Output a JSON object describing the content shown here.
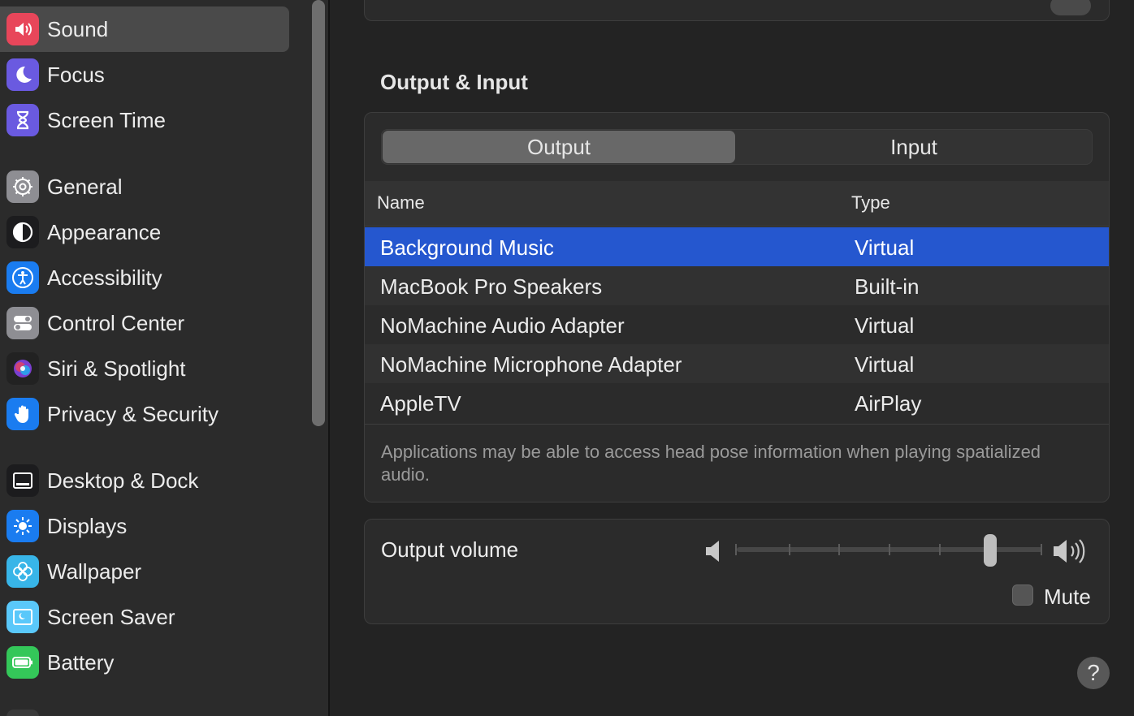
{
  "sidebar": {
    "items": [
      {
        "label": "Sound",
        "icon": "speaker-icon",
        "color": "#e8465a"
      },
      {
        "label": "Focus",
        "icon": "moon-icon",
        "color": "#6a5ae0"
      },
      {
        "label": "Screen Time",
        "icon": "hourglass-icon",
        "color": "#6a5ae0"
      },
      {
        "label": "General",
        "icon": "gear-icon",
        "color": "#8e8e93"
      },
      {
        "label": "Appearance",
        "icon": "appearance-icon",
        "color": "#1c1c1e"
      },
      {
        "label": "Accessibility",
        "icon": "accessibility-icon",
        "color": "#1a7cf0"
      },
      {
        "label": "Control Center",
        "icon": "toggles-icon",
        "color": "#8e8e93"
      },
      {
        "label": "Siri & Spotlight",
        "icon": "siri-icon",
        "color": "#222"
      },
      {
        "label": "Privacy & Security",
        "icon": "hand-icon",
        "color": "#1a7cf0"
      },
      {
        "label": "Desktop & Dock",
        "icon": "dock-icon",
        "color": "#1c1c1e"
      },
      {
        "label": "Displays",
        "icon": "sun-icon",
        "color": "#1a7cf0"
      },
      {
        "label": "Wallpaper",
        "icon": "flower-icon",
        "color": "#38b5e8"
      },
      {
        "label": "Screen Saver",
        "icon": "screensaver-icon",
        "color": "#5ac8fa"
      },
      {
        "label": "Battery",
        "icon": "battery-icon",
        "color": "#34c759"
      }
    ]
  },
  "main": {
    "section_title": "Output & Input",
    "tabs": {
      "output": "Output",
      "input": "Input"
    },
    "table": {
      "headers": {
        "name": "Name",
        "type": "Type"
      },
      "rows": [
        {
          "name": "Background Music",
          "type": "Virtual"
        },
        {
          "name": "MacBook Pro Speakers",
          "type": "Built-in"
        },
        {
          "name": "NoMachine Audio Adapter",
          "type": "Virtual"
        },
        {
          "name": "NoMachine Microphone Adapter",
          "type": "Virtual"
        },
        {
          "name": "AppleTV",
          "type": "AirPlay"
        }
      ]
    },
    "footnote": "Applications may be able to access head pose information when playing spatialized audio.",
    "volume": {
      "label": "Output volume",
      "level": 0.83,
      "mute_label": "Mute"
    },
    "help": "?",
    "accent": "#2557cf"
  }
}
